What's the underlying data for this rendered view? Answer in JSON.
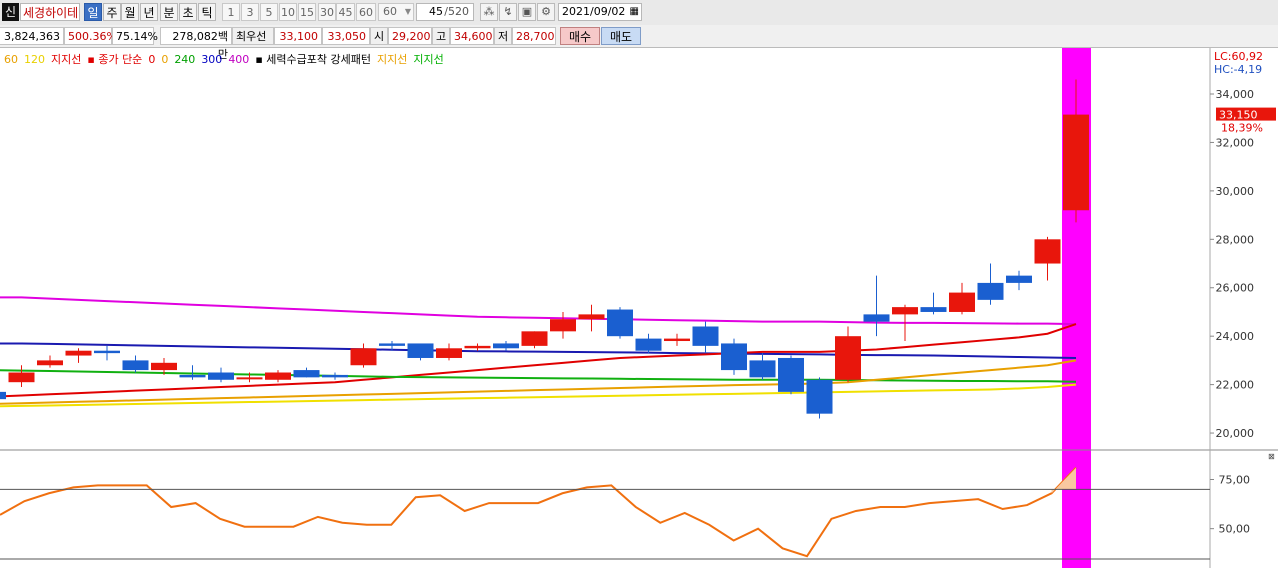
{
  "toolbar": {
    "app_icon": "신",
    "stock_name": "세경하이테",
    "periods": [
      "일",
      "주",
      "월",
      "년",
      "분",
      "초",
      "틱"
    ],
    "selected_period": "일",
    "intervals": [
      "1",
      "3",
      "5",
      "10",
      "15",
      "30",
      "45",
      "60"
    ],
    "interval_dropdown": "60",
    "count": "45",
    "count_total": "/520",
    "date": "2021/09/02",
    "icons": [
      "chart-link-icon",
      "draw-tool-icon",
      "save-icon",
      "settings-icon",
      "calendar-icon"
    ]
  },
  "info": {
    "volume": "3,824,363",
    "rate1": "500.36%",
    "rate2": "75.14%",
    "amount": "278,082백만",
    "best_label": "최우선",
    "best_ask": "33,100",
    "best_bid": "33,050",
    "open_label": "시",
    "open": "29,200",
    "high_label": "고",
    "high": "34,600",
    "low_label": "저",
    "low": "28,700",
    "buy_label": "매수",
    "sell_label": "매도"
  },
  "legend": [
    {
      "text": "60",
      "color": "#e8a000"
    },
    {
      "text": "120",
      "color": "#e8d000"
    },
    {
      "text": "지지선",
      "color": "#e00000"
    },
    {
      "text": "▪ 종가 단순",
      "color": "#e00000"
    },
    {
      "text": "0",
      "color": "#e00000"
    },
    {
      "text": "0",
      "color": "#e8a000"
    },
    {
      "text": "240",
      "color": "#00a000"
    },
    {
      "text": "300",
      "color": "#0000c0"
    },
    {
      "text": "400",
      "color": "#c000c0"
    },
    {
      "text": "▪ 세력수급포착 강세패턴",
      "color": "#000000"
    },
    {
      "text": "지지선",
      "color": "#e8a000"
    },
    {
      "text": "지지선",
      "color": "#00b000"
    }
  ],
  "axis": {
    "lc": "LC:60,92",
    "hc": "HC:-4,19",
    "price_ticks": [
      "34,000",
      "32,000",
      "30,000",
      "28,000",
      "26,000",
      "24,000",
      "22,000",
      "20,000"
    ],
    "current_price": "33,150",
    "current_change": "18,39%",
    "osc_ticks": [
      "75,00",
      "50,00"
    ]
  },
  "colors": {
    "up": "#e8160c",
    "down": "#1a5fd0",
    "highlight": "#ff00ff",
    "osc": "#f07010"
  },
  "chart_data": {
    "type": "candlestick",
    "ylim": [
      19300,
      35900
    ],
    "candles": [
      {
        "o": 21700,
        "h": 21800,
        "l": 21400,
        "c": 21400
      },
      {
        "o": 22100,
        "h": 22800,
        "l": 21900,
        "c": 22500
      },
      {
        "o": 22800,
        "h": 23200,
        "l": 22700,
        "c": 23000
      },
      {
        "o": 23200,
        "h": 23500,
        "l": 22900,
        "c": 23400
      },
      {
        "o": 23400,
        "h": 23600,
        "l": 23000,
        "c": 23300
      },
      {
        "o": 23000,
        "h": 23200,
        "l": 22500,
        "c": 22600
      },
      {
        "o": 22600,
        "h": 23100,
        "l": 22400,
        "c": 22900
      },
      {
        "o": 22400,
        "h": 22800,
        "l": 22200,
        "c": 22300
      },
      {
        "o": 22500,
        "h": 22700,
        "l": 22100,
        "c": 22200
      },
      {
        "o": 22300,
        "h": 22500,
        "l": 22100,
        "c": 22300
      },
      {
        "o": 22200,
        "h": 22600,
        "l": 22100,
        "c": 22500
      },
      {
        "o": 22600,
        "h": 22700,
        "l": 22300,
        "c": 22300
      },
      {
        "o": 22400,
        "h": 22500,
        "l": 22200,
        "c": 22300
      },
      {
        "o": 22800,
        "h": 23700,
        "l": 22700,
        "c": 23500
      },
      {
        "o": 23700,
        "h": 23800,
        "l": 23400,
        "c": 23600
      },
      {
        "o": 23700,
        "h": 23700,
        "l": 23000,
        "c": 23100
      },
      {
        "o": 23100,
        "h": 23700,
        "l": 23000,
        "c": 23500
      },
      {
        "o": 23500,
        "h": 23700,
        "l": 23400,
        "c": 23600
      },
      {
        "o": 23700,
        "h": 23800,
        "l": 23400,
        "c": 23500
      },
      {
        "o": 23600,
        "h": 24200,
        "l": 23500,
        "c": 24200
      },
      {
        "o": 24200,
        "h": 25000,
        "l": 23900,
        "c": 24700
      },
      {
        "o": 24700,
        "h": 25300,
        "l": 24200,
        "c": 24900
      },
      {
        "o": 25100,
        "h": 25200,
        "l": 23900,
        "c": 24000
      },
      {
        "o": 23900,
        "h": 24100,
        "l": 23300,
        "c": 23400
      },
      {
        "o": 23800,
        "h": 24100,
        "l": 23600,
        "c": 23900
      },
      {
        "o": 24400,
        "h": 24600,
        "l": 23300,
        "c": 23600
      },
      {
        "o": 23700,
        "h": 23900,
        "l": 22400,
        "c": 22600
      },
      {
        "o": 23000,
        "h": 23300,
        "l": 22200,
        "c": 22300
      },
      {
        "o": 23100,
        "h": 23200,
        "l": 21600,
        "c": 21700
      },
      {
        "o": 22200,
        "h": 22300,
        "l": 20600,
        "c": 20800
      },
      {
        "o": 22200,
        "h": 24400,
        "l": 22100,
        "c": 24000
      },
      {
        "o": 24900,
        "h": 26500,
        "l": 24000,
        "c": 24600
      },
      {
        "o": 24900,
        "h": 25300,
        "l": 23800,
        "c": 25200
      },
      {
        "o": 25200,
        "h": 25800,
        "l": 24900,
        "c": 25000
      },
      {
        "o": 25000,
        "h": 26200,
        "l": 24900,
        "c": 25800
      },
      {
        "o": 26200,
        "h": 27000,
        "l": 25300,
        "c": 25500
      },
      {
        "o": 26500,
        "h": 26700,
        "l": 25900,
        "c": 26200
      },
      {
        "o": 27000,
        "h": 28100,
        "l": 26300,
        "c": 28000
      },
      {
        "o": 29200,
        "h": 34600,
        "l": 28700,
        "c": 33150
      }
    ],
    "ma_lines": [
      {
        "name": "400",
        "color": "#e000e0",
        "values": [
          25600,
          25600,
          25550,
          25500,
          25450,
          25400,
          25350,
          25300,
          25250,
          25200,
          25150,
          25100,
          25050,
          25000,
          24950,
          24900,
          24850,
          24800,
          24780,
          24760,
          24740,
          24720,
          24700,
          24680,
          24660,
          24640,
          24620,
          24600,
          24600,
          24600,
          24580,
          24560,
          24550,
          24550,
          24540,
          24530,
          24520,
          24520,
          24500
        ]
      },
      {
        "name": "300",
        "color": "#1a1ab0",
        "values": [
          23700,
          23700,
          23680,
          23660,
          23640,
          23620,
          23600,
          23580,
          23560,
          23540,
          23520,
          23500,
          23480,
          23460,
          23440,
          23420,
          23400,
          23380,
          23370,
          23360,
          23350,
          23340,
          23330,
          23320,
          23300,
          23290,
          23280,
          23270,
          23260,
          23250,
          23230,
          23220,
          23210,
          23200,
          23180,
          23160,
          23140,
          23120,
          23100
        ]
      },
      {
        "name": "종가",
        "color": "#e00000",
        "values": [
          21500,
          21550,
          21600,
          21650,
          21700,
          21750,
          21800,
          21850,
          21900,
          21950,
          22000,
          22050,
          22100,
          22200,
          22300,
          22400,
          22500,
          22600,
          22700,
          22800,
          22900,
          23000,
          23100,
          23150,
          23200,
          23250,
          23300,
          23350,
          23350,
          23350,
          23400,
          23450,
          23550,
          23650,
          23750,
          23850,
          23950,
          24100,
          24500
        ]
      },
      {
        "name": "240",
        "color": "#10b010",
        "values": [
          22600,
          22580,
          22560,
          22540,
          22520,
          22500,
          22480,
          22460,
          22440,
          22420,
          22400,
          22380,
          22360,
          22340,
          22320,
          22310,
          22300,
          22290,
          22280,
          22270,
          22260,
          22250,
          22240,
          22230,
          22220,
          22210,
          22200,
          22200,
          22200,
          22200,
          22190,
          22180,
          22170,
          22160,
          22150,
          22150,
          22140,
          22140,
          22120
        ]
      },
      {
        "name": "60",
        "color": "#e8a000",
        "values": [
          21200,
          21230,
          21260,
          21290,
          21320,
          21350,
          21380,
          21410,
          21440,
          21470,
          21500,
          21530,
          21560,
          21590,
          21620,
          21650,
          21680,
          21710,
          21740,
          21770,
          21800,
          21830,
          21860,
          21890,
          21920,
          21950,
          21980,
          22000,
          22020,
          22050,
          22100,
          22200,
          22300,
          22400,
          22500,
          22600,
          22700,
          22800,
          23000
        ]
      },
      {
        "name": "120",
        "color": "#f0e000",
        "values": [
          21100,
          21120,
          21140,
          21160,
          21180,
          21200,
          21220,
          21240,
          21260,
          21280,
          21300,
          21320,
          21340,
          21360,
          21380,
          21400,
          21420,
          21440,
          21460,
          21480,
          21500,
          21520,
          21540,
          21560,
          21580,
          21600,
          21620,
          21640,
          21660,
          21680,
          21700,
          21720,
          21740,
          21760,
          21780,
          21800,
          21840,
          21900,
          22000
        ]
      }
    ],
    "oscillator": {
      "ylim": [
        30,
        90
      ],
      "values": [
        57,
        64,
        68,
        71,
        72,
        72,
        72,
        61,
        63,
        55,
        51,
        51,
        51,
        56,
        53,
        52,
        52,
        66,
        67,
        59,
        63,
        63,
        63,
        68,
        71,
        72,
        61,
        53,
        58,
        52,
        44,
        50,
        40,
        36,
        55,
        59,
        61,
        61,
        63,
        64,
        65,
        60,
        62,
        68,
        81
      ]
    }
  }
}
